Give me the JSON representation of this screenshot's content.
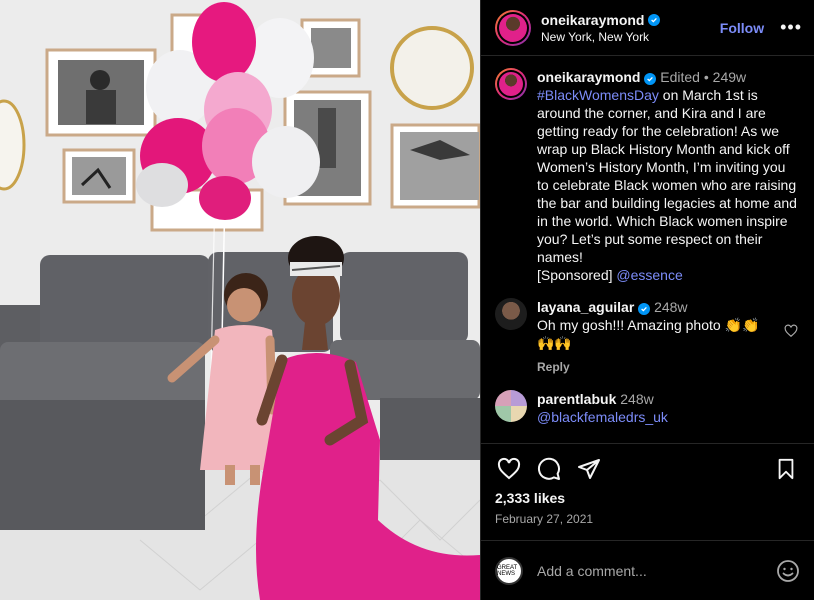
{
  "post": {
    "username": "oneikaraymond",
    "location": "New York, New York",
    "follow_label": "Follow",
    "more_label": "•••"
  },
  "caption": {
    "username": "oneikaraymond",
    "edited": "Edited",
    "age": "249w",
    "hashtag": "#BlackWomensDay",
    "text": " on March 1st is around the corner, and Kira and I are getting ready for the celebration! As we wrap up Black History Month and kick off Women’s History Month, I’m inviting you to celebrate Black women who are raising the bar and building legacies at home and in the world.  Which Black women inspire you? Let’s put some respect on their names!",
    "sponsored": "[Sponsored] ",
    "mention": "@essence"
  },
  "comments": [
    {
      "username": "layana_aguilar",
      "age": "248w",
      "text": "Oh my gosh!!! Amazing photo 👏👏 🙌🙌",
      "reply_label": "Reply"
    },
    {
      "username": "parentlabuk",
      "age": "248w",
      "text": "@blackfemaledrs_uk"
    }
  ],
  "stats": {
    "likes": "2,333 likes",
    "date": "February 27, 2021"
  },
  "composer": {
    "placeholder": "Add a comment...",
    "avatar_text": "GREAT NEWS"
  },
  "icons": {
    "like": "heart-icon",
    "comment": "comment-icon",
    "share": "share-icon",
    "save": "bookmark-icon",
    "emoji": "emoji-icon"
  },
  "colors": {
    "accent": "#7c8cf8",
    "verified": "#0095f6",
    "dress": "#e0218a"
  }
}
